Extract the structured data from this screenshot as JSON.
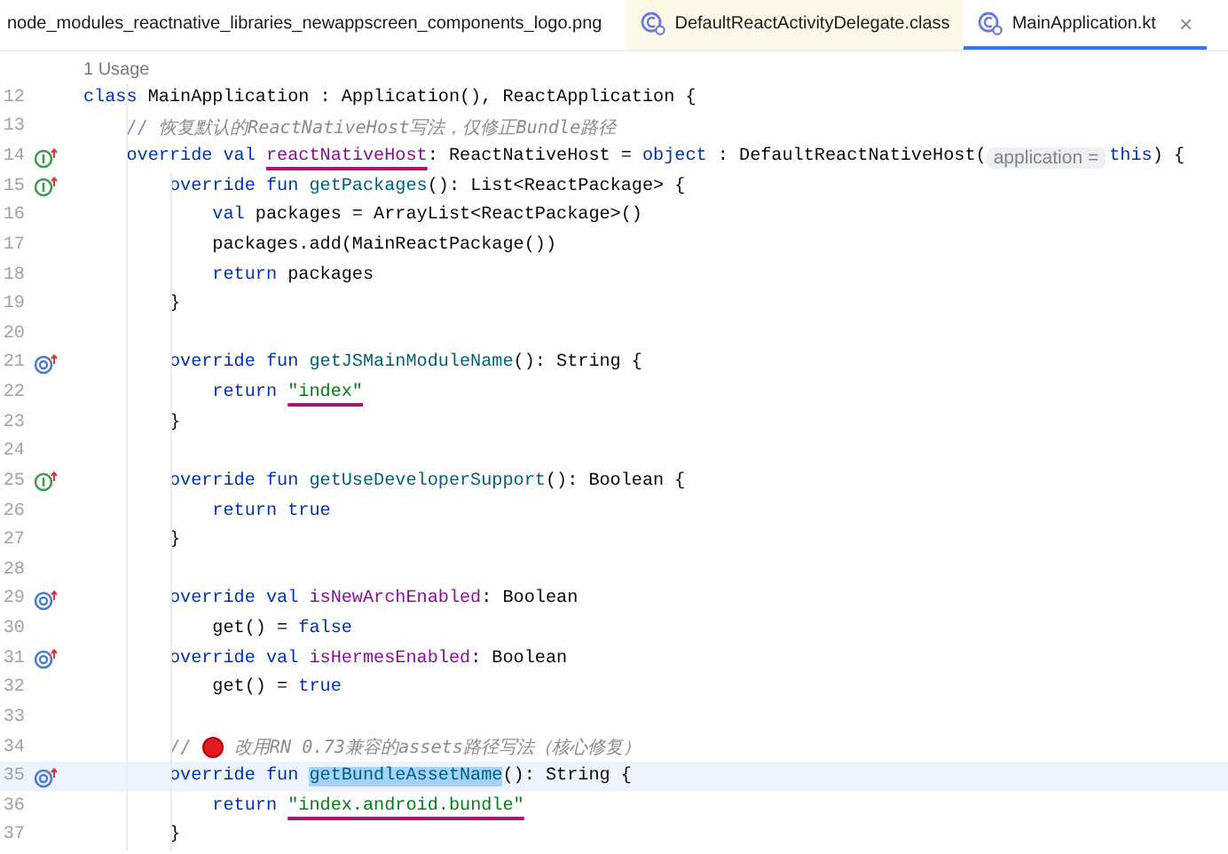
{
  "tabs": [
    {
      "label": "node_modules_reactnative_libraries_newappscreen_components_logo.png",
      "kind": "image",
      "selected": false
    },
    {
      "label": "DefaultReactActivityDelegate.class",
      "kind": "class",
      "selected": false
    },
    {
      "label": "MainApplication.kt",
      "kind": "class",
      "selected": true,
      "close": "×"
    }
  ],
  "usage_hint": "1 Usage",
  "lines": [
    {
      "number": "12",
      "current": false,
      "tokens": [
        {
          "text": "class ",
          "kind": "kw"
        },
        {
          "text": "MainApplication : Application(), ReactApplication {",
          "kind": "plain"
        }
      ]
    },
    {
      "number": "13",
      "current": false,
      "tokens": [
        {
          "text": "    // 恢复默认的ReactNativeHost写法，仅修正Bundle路径",
          "kind": "comment"
        }
      ]
    },
    {
      "number": "14",
      "current": false,
      "kind": "implements",
      "tokens": [
        {
          "text": "    override val ",
          "kind": "kw"
        },
        {
          "text": "reactNativeHost",
          "kind": "prop",
          "underlined": true
        },
        {
          "text": ": ReactNativeHost = ",
          "kind": "plain"
        },
        {
          "text": "object",
          "kind": "kw"
        },
        {
          "text": " : DefaultReactNativeHost(",
          "kind": "plain"
        },
        {
          "text": "application =",
          "kind": "hint"
        },
        {
          "text": "this",
          "kind": "kw"
        },
        {
          "text": ") {",
          "kind": "plain"
        }
      ]
    },
    {
      "number": "15",
      "current": false,
      "kind": "implements",
      "tokens": [
        {
          "text": "        override fun ",
          "kind": "kw"
        },
        {
          "text": "getPackages",
          "kind": "fn"
        },
        {
          "text": "(): List<ReactPackage> {",
          "kind": "plain"
        }
      ]
    },
    {
      "number": "16",
      "current": false,
      "tokens": [
        {
          "text": "            val ",
          "kind": "kw"
        },
        {
          "text": "packages = ArrayList<ReactPackage>()",
          "kind": "plain"
        }
      ]
    },
    {
      "number": "17",
      "current": false,
      "tokens": [
        {
          "text": "            packages.add(MainReactPackage())",
          "kind": "plain"
        }
      ]
    },
    {
      "number": "18",
      "current": false,
      "tokens": [
        {
          "text": "            return ",
          "kind": "kw"
        },
        {
          "text": "packages",
          "kind": "plain"
        }
      ]
    },
    {
      "number": "19",
      "current": false,
      "tokens": [
        {
          "text": "        }",
          "kind": "plain"
        }
      ]
    },
    {
      "number": "20",
      "current": false
    },
    {
      "number": "21",
      "current": false,
      "kind": "overrides",
      "tokens": [
        {
          "text": "        override fun ",
          "kind": "kw"
        },
        {
          "text": "getJSMainModuleName",
          "kind": "fn"
        },
        {
          "text": "(): String {",
          "kind": "plain"
        }
      ]
    },
    {
      "number": "22",
      "current": false,
      "tokens": [
        {
          "text": "            return ",
          "kind": "kw"
        },
        {
          "text": "\"index\"",
          "kind": "str",
          "underlined": true
        }
      ]
    },
    {
      "number": "23",
      "current": false,
      "tokens": [
        {
          "text": "        }",
          "kind": "plain"
        }
      ]
    },
    {
      "number": "24",
      "current": false
    },
    {
      "number": "25",
      "current": false,
      "kind": "implements",
      "tokens": [
        {
          "text": "        override fun ",
          "kind": "kw"
        },
        {
          "text": "getUseDeveloperSupport",
          "kind": "fn"
        },
        {
          "text": "(): Boolean {",
          "kind": "plain"
        }
      ]
    },
    {
      "number": "26",
      "current": false,
      "tokens": [
        {
          "text": "            return true",
          "kind": "kw"
        }
      ]
    },
    {
      "number": "27",
      "current": false,
      "tokens": [
        {
          "text": "        }",
          "kind": "plain"
        }
      ]
    },
    {
      "number": "28",
      "current": false
    },
    {
      "number": "29",
      "current": false,
      "kind": "overrides",
      "tokens": [
        {
          "text": "        override val ",
          "kind": "kw"
        },
        {
          "text": "isNewArchEnabled",
          "kind": "prop"
        },
        {
          "text": ": Boolean",
          "kind": "plain"
        }
      ]
    },
    {
      "number": "30",
      "current": false,
      "tokens": [
        {
          "text": "            get() = ",
          "kind": "plain"
        },
        {
          "text": "false",
          "kind": "kw"
        }
      ]
    },
    {
      "number": "31",
      "current": false,
      "kind": "overrides",
      "tokens": [
        {
          "text": "        override val ",
          "kind": "kw"
        },
        {
          "text": "isHermesEnabled",
          "kind": "prop"
        },
        {
          "text": ": Boolean",
          "kind": "plain"
        }
      ]
    },
    {
      "number": "32",
      "current": false,
      "tokens": [
        {
          "text": "            get() = ",
          "kind": "plain"
        },
        {
          "text": "true",
          "kind": "kw"
        }
      ]
    },
    {
      "number": "33",
      "current": false
    },
    {
      "number": "34",
      "current": false,
      "tokens": [
        {
          "text": "        // ",
          "kind": "comment"
        },
        {
          "kind": "dot"
        },
        {
          "text": " 改用RN 0.73兼容的assets路径写法（核心修复）",
          "kind": "comment"
        }
      ]
    },
    {
      "number": "35",
      "current": true,
      "kind": "overrides",
      "tokens": [
        {
          "text": "        override fun ",
          "kind": "kw"
        },
        {
          "text": "getBundleAssetName",
          "kind": "fn",
          "selected": true
        },
        {
          "text": "(): String {",
          "kind": "plain"
        }
      ]
    },
    {
      "number": "36",
      "current": false,
      "tokens": [
        {
          "text": "            return ",
          "kind": "kw"
        },
        {
          "text": "\"index.android.bundle\"",
          "kind": "str",
          "underlined": true
        }
      ]
    },
    {
      "number": "37",
      "current": false,
      "tokens": [
        {
          "text": "        }",
          "kind": "plain"
        }
      ]
    }
  ]
}
